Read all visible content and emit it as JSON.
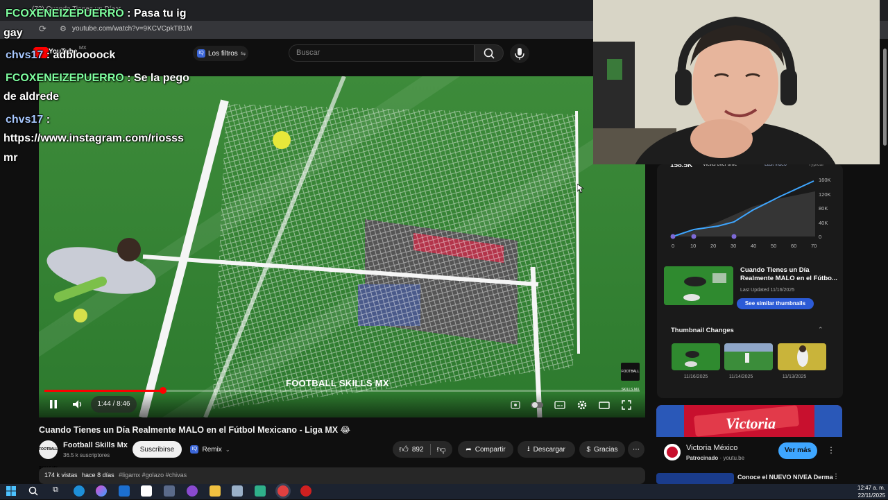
{
  "browser": {
    "tab_title": "(73) Cuando Tienes un Día",
    "url": "youtube.com/watch?v=9KCVCpkTB1M"
  },
  "youtube": {
    "logo_text": "YouTube",
    "country": "MX",
    "filters_label": "Los filtros",
    "search_placeholder": "Buscar"
  },
  "player": {
    "watermark": "FOOTBALL SKILLS MX",
    "channel_logo_text": "FOOTBALL SKILLS MX",
    "time_display": "1:44 / 8:46",
    "progress_fraction": 0.199
  },
  "video": {
    "title": "Cuando Tienes un Día Realmente MALO en el Fútbol Mexicano - Liga MX 😂",
    "channel_name": "Football Skills Mx",
    "channel_avatar_text": "FOOTBALL SKILLS MX",
    "subscribers": "36.5 k suscriptores",
    "subscribe_label": "Suscribirse",
    "remix_label": "Remix",
    "likes": "892",
    "share_label": "Compartir",
    "download_label": "Descargar",
    "thanks_label": "Gracias",
    "views": "174 k vistas",
    "date": "hace 8 días",
    "tags": "#ligamx #golazo #chivas"
  },
  "stats_panel": {
    "big_value": "158.5K",
    "range_select": "Views over time",
    "latest_label": "Last video",
    "typical_label": "Typical",
    "chart_y_ticks": [
      "160K",
      "120K",
      "80K",
      "40K",
      "0"
    ],
    "chart_x_ticks": [
      "0",
      "10",
      "20",
      "30",
      "40",
      "50",
      "60",
      "70"
    ],
    "suggested_title": "Cuando Tienes un Día Realmente MALO en el Fútbo...",
    "suggested_updated": "Last Updated 11/16/2025",
    "see_similar_label": "See similar thumbnails",
    "thumbnail_changes_title": "Thumbnail Changes",
    "thumbnail_dates": [
      "11/16/2025",
      "11/14/2025",
      "11/13/2025"
    ]
  },
  "ad": {
    "banner_text": "Victoria",
    "advertiser": "Victoria México",
    "sponsored": "Patrocinado",
    "domain": "youtu.be",
    "cta_label": "Ver más"
  },
  "next_video": {
    "title": "Conoce el NUEVO NIVEA Derma"
  },
  "chat": [
    {
      "user": "FCOXENEIZEPUERRO",
      "sep": " : ",
      "text": "Pasa tu ig",
      "cont": "gay"
    },
    {
      "user": "chvs17",
      "sep": " : ",
      "text": "adbloooock",
      "cont": ""
    },
    {
      "user": "FCOXENEIZEPUERRO",
      "sep": " : ",
      "text": "Se la pego",
      "cont": "de aldrede"
    },
    {
      "user": "chvs17",
      "sep": " :",
      "text": "",
      "cont": "https://www.instagram.com/riosss",
      "cont2": "mr"
    }
  ],
  "taskbar": {
    "time": "12:47 a. m.",
    "date": "22/11/2025"
  },
  "colors": {
    "yt_red": "#ff0000",
    "accent_blue": "#3ea6ff",
    "chat_user_green": "#7fffa0",
    "chat_user_blue": "#a8c8ff"
  }
}
